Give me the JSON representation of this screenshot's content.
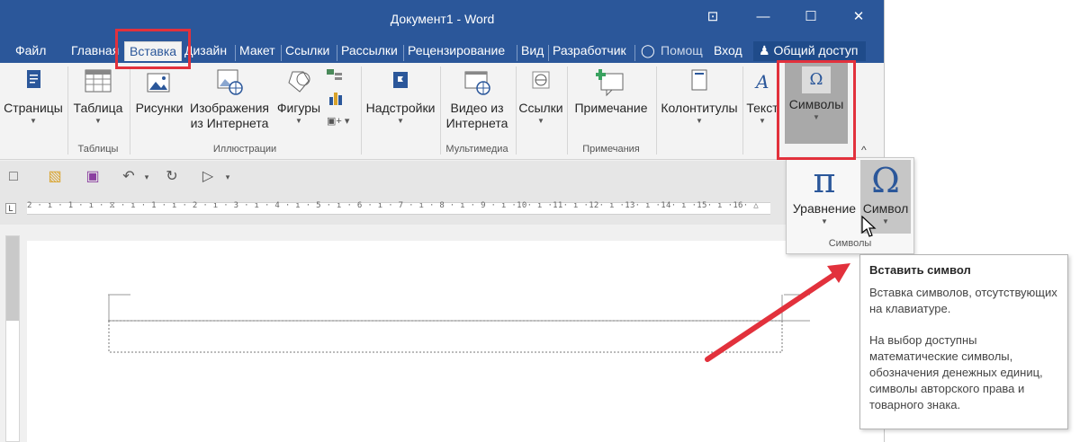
{
  "titlebar": {
    "title": "Документ1 - Word",
    "ribbon_display_icon": "⊡",
    "minimize_icon": "—",
    "maximize_icon": "☐",
    "close_icon": "✕"
  },
  "tabs": {
    "file": "Файл",
    "home": "Главная",
    "insert": "Вставка",
    "design": "Дизайн",
    "layout": "Макет",
    "references": "Ссылки",
    "mailings": "Рассылки",
    "review": "Рецензирование",
    "view": "Вид",
    "developer": "Разработчик",
    "tell_me": "Помощ",
    "sign_in": "Вход",
    "share": "Общий доступ"
  },
  "ribbon": {
    "pages": "Страницы",
    "table": "Таблица",
    "pictures": "Рисунки",
    "online_pictures_1": "Изображения",
    "online_pictures_2": "из Интернета",
    "shapes": "Фигуры",
    "addins": "Надстройки",
    "online_video_1": "Видео из",
    "online_video_2": "Интернета",
    "links": "Ссылки",
    "comment": "Примечание",
    "header_footer": "Колонтитулы",
    "text": "Текст",
    "symbols": "Символы",
    "groups": {
      "tables": "Таблицы",
      "illustrations": "Иллюстрации",
      "media": "Мультимедиа",
      "comments": "Примечания"
    }
  },
  "symbols_panel": {
    "equation": "Уравнение",
    "equation_glyph": "π",
    "symbol": "Символ",
    "symbol_glyph": "Ω",
    "group_label": "Символы"
  },
  "ruler": {
    "ticks": "2 · ı · 1 · ı · ⧖ · ı · 1 · ı · 2 · ı · 3 · ı · 4 · ı · 5 · ı · 6 · ı · 7 · ı · 8 · ı · 9 · ı ·10· ı ·11· ı ·12· ı ·13· ı ·14· ı ·15· ı ·16· △"
  },
  "tooltip": {
    "title": "Вставить символ",
    "line1": "Вставка символов, отсутствующих на клавиатуре.",
    "line2": "На выбор доступны математические символы, обозначения денежных единиц, символы авторского права и товарного знака."
  },
  "colors": {
    "word_blue": "#2b579a",
    "highlight_red": "#e2313c"
  }
}
